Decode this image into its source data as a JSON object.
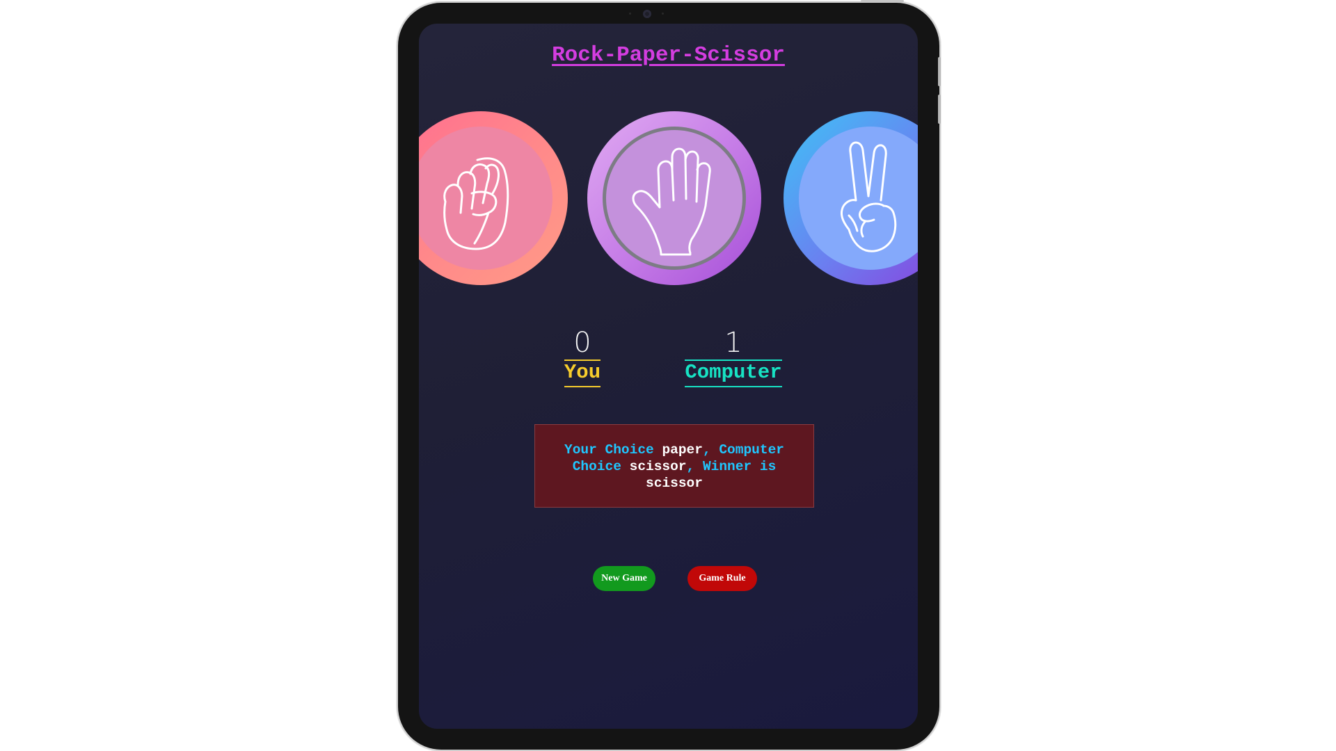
{
  "title": "Rock-Paper-Scissor",
  "choices": [
    {
      "id": "rock",
      "icon": "fist-icon"
    },
    {
      "id": "paper",
      "icon": "open-hand-icon"
    },
    {
      "id": "scissor",
      "icon": "peace-hand-icon"
    }
  ],
  "scores": {
    "you": {
      "value": "0",
      "label": "You"
    },
    "computer": {
      "value": "1",
      "label": "Computer"
    }
  },
  "result": {
    "your_choice_label": "Your Choice",
    "your_choice": "paper",
    "computer_choice_label": "Computer Choice",
    "computer_choice": "scissor",
    "winner_label": "Winner is",
    "winner": "scissor"
  },
  "buttons": {
    "new_game": "New Game",
    "game_rule": "Game Rule"
  },
  "colors": {
    "title": "#d43de0",
    "you": "#f6cc2c",
    "computer": "#17e3c4",
    "result_bg": "#5e1720",
    "new_game_bg": "#129a1e",
    "game_rule_bg": "#c10808"
  }
}
